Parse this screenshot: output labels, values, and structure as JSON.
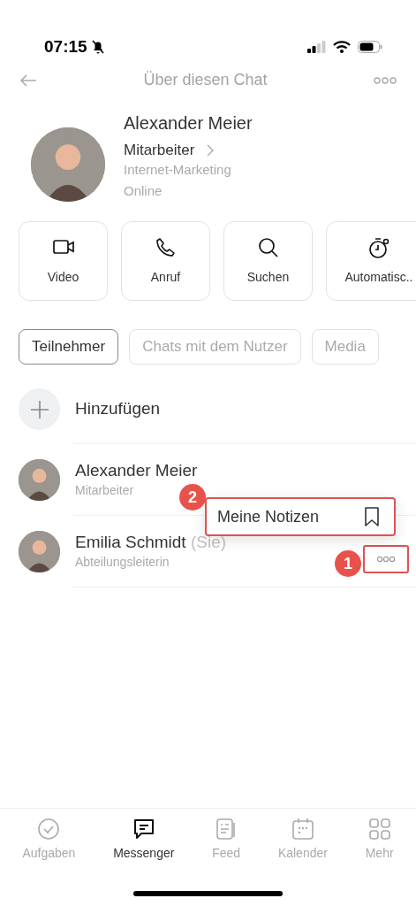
{
  "status_bar": {
    "time": "07:15"
  },
  "header": {
    "title": "Über diesen Chat"
  },
  "profile": {
    "name": "Alexander Meier",
    "role": "Mitarbeiter",
    "department": "Internet-Marketing",
    "status": "Online"
  },
  "actions": [
    {
      "kind": "video",
      "label": "Video"
    },
    {
      "kind": "call",
      "label": "Anruf"
    },
    {
      "kind": "search",
      "label": "Suchen"
    },
    {
      "kind": "timer",
      "label": "Automatisc.."
    }
  ],
  "tabs": [
    {
      "label": "Teilnehmer",
      "selected": true
    },
    {
      "label": "Chats mit dem Nutzer",
      "selected": false
    },
    {
      "label": "Media",
      "selected": false
    }
  ],
  "add_member": {
    "label": "Hinzufügen"
  },
  "members": [
    {
      "name": "Alexander Meier",
      "role": "Mitarbeiter",
      "menu_button": false
    },
    {
      "name": "Emilia Schmidt",
      "self_label": "(Sie)",
      "role": "Abteilungsleiterin",
      "menu_button": true
    }
  ],
  "context_menu": {
    "label": "Meine Notizen"
  },
  "callouts": [
    "1",
    "2"
  ],
  "bottom_nav": [
    {
      "kind": "tasks",
      "label": "Aufgaben",
      "selected": false
    },
    {
      "kind": "messenger",
      "label": "Messenger",
      "selected": true
    },
    {
      "kind": "feed",
      "label": "Feed",
      "selected": false
    },
    {
      "kind": "calendar",
      "label": "Kalender",
      "selected": false
    },
    {
      "kind": "more",
      "label": "Mehr",
      "selected": false
    }
  ]
}
